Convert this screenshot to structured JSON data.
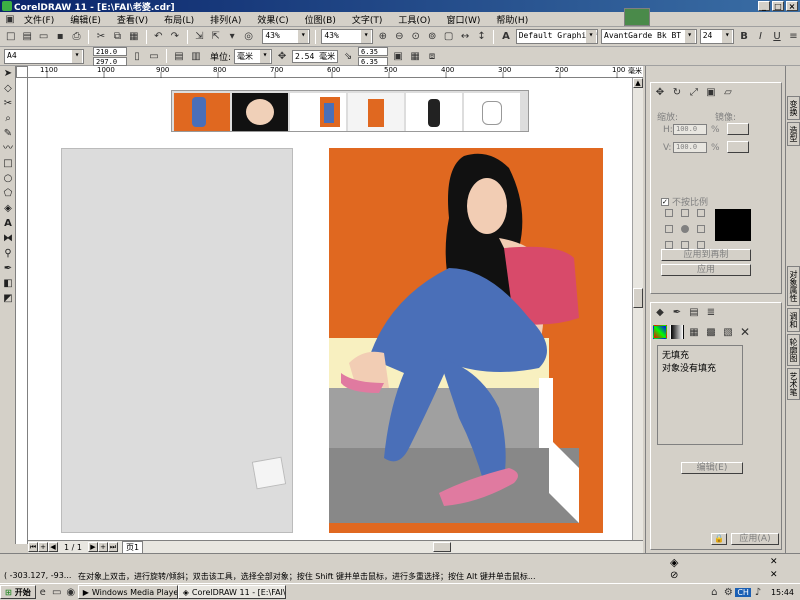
{
  "window": {
    "title": "CorelDRAW 11 - [E:\\FAI\\老婆.cdr]"
  },
  "menu": [
    "文件(F)",
    "编辑(E)",
    "查看(V)",
    "布局(L)",
    "排列(A)",
    "效果(C)",
    "位图(B)",
    "文字(T)",
    "工具(O)",
    "窗口(W)",
    "帮助(H)"
  ],
  "toolbar": {
    "zoom_value_1": "43%",
    "zoom_value_2": "43%",
    "font_style": "Default Graphic *",
    "font_name": "AvantGarde Bk BT",
    "font_size": "24"
  },
  "propertybar": {
    "paper_size": "A4",
    "width": "210.0",
    "height": "297.0",
    "units_label": "单位:",
    "units_value": "毫米",
    "nudge": "2.54 毫米",
    "dup_x": "6.35",
    "dup_y": "6.35"
  },
  "ruler": {
    "h_ticks": [
      "1100",
      "1000",
      "900",
      "800",
      "700",
      "600",
      "500",
      "400",
      "300",
      "200",
      "100"
    ],
    "unit": "毫米"
  },
  "page_nav": {
    "counter": "1 / 1",
    "page_tab": "页1"
  },
  "docker_transform": {
    "scale_label": "缩放:",
    "mirror_label": "镜像:",
    "x_value": "100.0",
    "y_value": "100.0",
    "percent": "%",
    "proportional_label": "不按比例",
    "apply_copy_button": "应用到再制",
    "apply_button": "应用"
  },
  "docker_fill": {
    "no_fill": "无填充",
    "object_no_fill": "对象没有填充",
    "edit_button": "编辑(E)",
    "apply_button": "应用(A)"
  },
  "side_tabs": [
    "变换",
    "造型",
    "对象属性",
    "调和",
    "轮廓图",
    "艺术笔"
  ],
  "status": {
    "coords": "( -303.127, -93...",
    "hint": "在对象上双击，进行旋转/倾斜；双击该工具，选择全部对象；按住 Shift 键并单击鼠标，进行多重选择；按住 Alt 键并单击鼠标..."
  },
  "taskbar": {
    "start": "开始",
    "tasks": [
      "Windows Media Player",
      "CorelDRAW 11 - [E:\\FAI\\..."
    ],
    "tray_lang": "CH",
    "clock": "15:44"
  },
  "colors": {
    "title_gradient_start": "#0a246a",
    "artwork_bg": "#e06820",
    "jeans": "#4a6fb8",
    "top": "#d84a6a"
  }
}
